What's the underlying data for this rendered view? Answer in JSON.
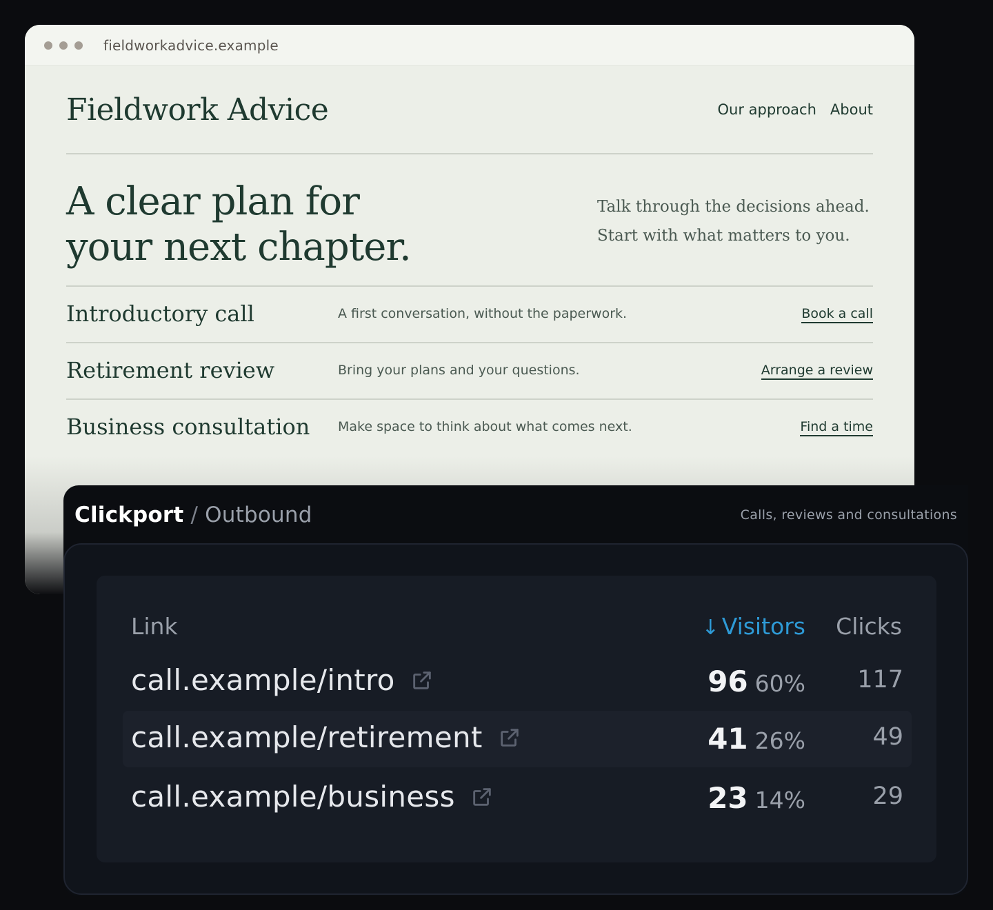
{
  "browser": {
    "url": "fieldworkadvice.example"
  },
  "site": {
    "logo": "Fieldwork Advice",
    "nav": [
      "Our approach",
      "About"
    ],
    "hero_title_line1": "A clear plan for",
    "hero_title_line2": "your next chapter.",
    "hero_sub_line1": "Talk through the decisions ahead.",
    "hero_sub_line2": "Start with what matters to you.",
    "services": [
      {
        "name": "Introductory call",
        "desc": "A first conversation, without the paperwork.",
        "link": "Book a call"
      },
      {
        "name": "Retirement review",
        "desc": "Bring your plans and your questions.",
        "link": "Arrange a review"
      },
      {
        "name": "Business consultation",
        "desc": "Make space to think about what comes next.",
        "link": "Find a time"
      }
    ]
  },
  "panel": {
    "app": "Clickport",
    "separator": " / ",
    "section": "Outbound",
    "note": "Calls, reviews and consultations",
    "columns": {
      "link": "Link",
      "visitors": "Visitors",
      "clicks": "Clicks",
      "sort_arrow": "↓"
    },
    "rows": [
      {
        "link": "call.example/intro",
        "visitors": "96",
        "pct": "60%",
        "clicks": "117"
      },
      {
        "link": "call.example/retirement",
        "visitors": "41",
        "pct": "26%",
        "clicks": "49"
      },
      {
        "link": "call.example/business",
        "visitors": "23",
        "pct": "14%",
        "clicks": "29"
      }
    ],
    "accent_color": "#2e9ad6"
  }
}
